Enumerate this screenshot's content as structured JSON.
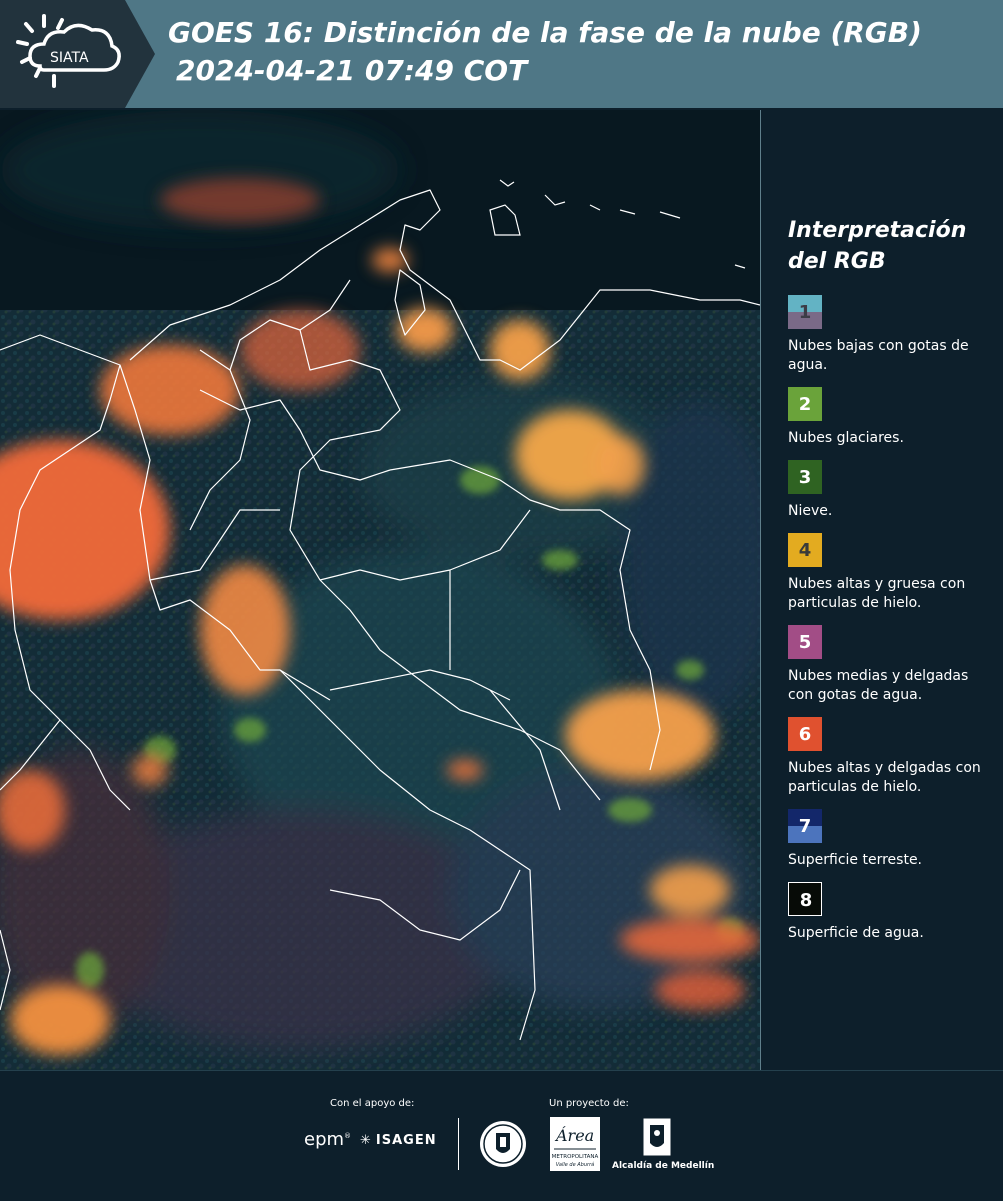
{
  "header": {
    "logo_text": "SIATA",
    "title_line1": "GOES 16: Distinción de la fase de la nube (RGB)",
    "title_line2": "2024-04-21 07:49 COT"
  },
  "legend": {
    "title": "Interpretación del RGB",
    "items": [
      {
        "number": "1",
        "label": "Nubes bajas con gotas de agua.",
        "color_top": "#63b3c4",
        "color_bottom": "#7a6a87",
        "number_color": "#3c3c46"
      },
      {
        "number": "2",
        "label": "Nubes glaciares.",
        "color_top": "#6aa33a",
        "color_bottom": "#6aa33a",
        "number_color": "#ffffff"
      },
      {
        "number": "3",
        "label": "Nieve.",
        "color_top": "#2f6322",
        "color_bottom": "#2f6322",
        "number_color": "#ffffff"
      },
      {
        "number": "4",
        "label": "Nubes altas y gruesa con particulas de hielo.",
        "color_top": "#e3ab20",
        "color_bottom": "#e3ab20",
        "number_color": "#3a3a3a"
      },
      {
        "number": "5",
        "label": "Nubes medias y delgadas con gotas de agua.",
        "color_top": "#a24d86",
        "color_bottom": "#a24d86",
        "number_color": "#ffffff"
      },
      {
        "number": "6",
        "label": "Nubes altas y delgadas con particulas de hielo.",
        "color_top": "#e0512f",
        "color_bottom": "#e0512f",
        "number_color": "#ffffff"
      },
      {
        "number": "7",
        "label": "Superficie terreste.",
        "color_top": "#13276a",
        "color_bottom": "#4c74bd",
        "number_color": "#ffffff"
      },
      {
        "number": "8",
        "label": "Superficie de agua.",
        "color_top": "#070b07",
        "color_bottom": "#070b07",
        "number_color": "#ffffff"
      }
    ]
  },
  "footer": {
    "support_label": "Con el apoyo de:",
    "project_label": "Un proyecto de:",
    "epm": "epm",
    "isagen": "ISAGEN",
    "amva_line1": "METROPOLITANA",
    "amva_line2": "Valle de Aburrá",
    "amva_script": "Área",
    "alcaldia": "Alcaldía de Medellín"
  },
  "colors": {
    "header_bg": "#4f7786",
    "logo_bg": "#22333d",
    "page_bg": "#0d1f2b",
    "cloud_ice": "#f0783a",
    "cloud_thick_ice": "#f7a24a",
    "glacial_green": "#6aa33a"
  }
}
